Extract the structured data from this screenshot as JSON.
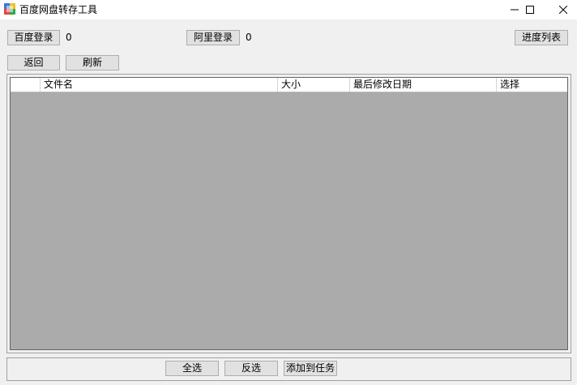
{
  "window": {
    "title": "百度网盘转存工具"
  },
  "toolbar": {
    "baidu_login_label": "百度登录",
    "baidu_count": "0",
    "ali_login_label": "阿里登录",
    "ali_count": "0",
    "progress_list_label": "进度列表",
    "back_label": "返回",
    "refresh_label": "刷新"
  },
  "table": {
    "columns": [
      "",
      "文件名",
      "大小",
      "最后修改日期",
      "选择"
    ],
    "rows": []
  },
  "footer": {
    "select_all_label": "全选",
    "invert_selection_label": "反选",
    "add_to_task_label": "添加到任务"
  },
  "colors": {
    "window_bg": "#f0f0f0",
    "grid_bg": "#ababab",
    "button_bg": "#e1e1e1",
    "button_border": "#adadad"
  },
  "icons": {
    "app": "app-icon",
    "minimize": "minimize-icon",
    "maximize": "maximize-icon",
    "close": "close-icon"
  }
}
